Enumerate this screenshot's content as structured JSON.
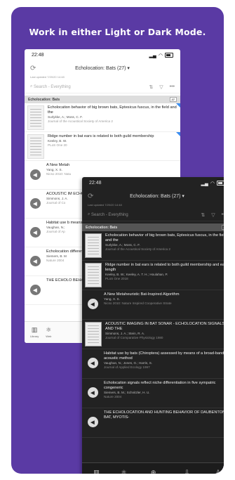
{
  "headline": "Work in either Light or Dark Mode.",
  "light": {
    "time": "22:48",
    "nav_title": "Echolocation: Bats (27)",
    "updated": "Last updated 7/20/20 14:48",
    "search_placeholder": "Search - Everything",
    "section": "Echolocation: Bats",
    "section_badge": "27",
    "items": [
      {
        "title": "Echolocation behavior of big brown bats, Eptesicus fuscus, in the field and the",
        "authors": "Surlykke, A.; Moss, C. F.",
        "journal": "Journal of the Acoustical Society of America 2"
      },
      {
        "title": "Ridge number in bat ears is related to both guild membership",
        "authors": "Keeley, B. W.",
        "journal": "PLoS One 20"
      },
      {
        "title": "A New Metah",
        "authors": "Yang, X. S.",
        "journal": "Nicso 2010: Natu"
      },
      {
        "title": "ACOUSTIC IM ECHOLOCATI",
        "authors": "Simmons, J. A.",
        "journal": "Journal of Co"
      },
      {
        "title": "Habitat use b means of a b",
        "authors": "Vaughan, N.;",
        "journal": "Journal of Ap"
      },
      {
        "title": "Echolocation differentiatio",
        "authors": "Siemers, B. M",
        "journal": "Nature 2004"
      },
      {
        "title": "THE ECHOLO BEHAVIOR O",
        "authors": "",
        "journal": ""
      }
    ],
    "tabs": [
      {
        "icon": "▥",
        "label": "Library"
      },
      {
        "icon": "⚛",
        "label": "Web"
      }
    ]
  },
  "dark": {
    "time": "22:48",
    "nav_title": "Echolocation: Bats (27)",
    "updated": "Last updated 7/20/20 14:48",
    "search_placeholder": "Search - Everything",
    "section": "Echolocation: Bats",
    "section_badge": "27",
    "items": [
      {
        "title": "Echolocation behavior of big brown bats, Eptesicus fuscus, in the field and the",
        "authors": "Surlykke, A.; Moss, C. F.",
        "journal": "Journal of the Acoustical Society of America 2"
      },
      {
        "title": "Ridge number in bat ears is related to both guild membership and ear length",
        "authors": "Keeley, B. W.; Keeley, A. T. H.; Houlahan, P.",
        "journal": "PLoS One 2018"
      },
      {
        "title": "A New Metaheuristic Bat-Inspired Algorithm",
        "authors": "Yang, X. S.",
        "journal": "Nicso 2010: Nature Inspired Cooperative Strate"
      },
      {
        "title": "ACOUSTIC IMAGING IN BAT SONAR - ECHOLOCATION SIGNALS AND THE",
        "authors": "Simmons, J. A.; Stein, R. A.",
        "journal": "Journal of Comparative Physiology 1980"
      },
      {
        "title": "Habitat use by bats (Chiroptera) assessed by means of a broad-band acoustic method",
        "authors": "Vaughan, N.; Jones, G.; Harris, S.",
        "journal": "Journal of Applied Ecology 1997"
      },
      {
        "title": "Echolocation signals reflect niche differentiation in five sympatric congeneric",
        "authors": "Siemers, B. M.; Schnitzler, H. U.",
        "journal": "Nature 2004"
      },
      {
        "title": "THE ECHOLOCATION AND HUNTING BEHAVIOR OF DAUBENTON BAT, MYOTIS-",
        "authors": "",
        "journal": ""
      }
    ],
    "tabs": [
      {
        "icon": "▥",
        "label": "Library"
      },
      {
        "icon": "⚛",
        "label": "Web"
      },
      {
        "icon": "⊕",
        "label": "Reference"
      },
      {
        "icon": "⇩",
        "label": "Downloads"
      },
      {
        "icon": "♙",
        "label": "Profile"
      }
    ]
  }
}
